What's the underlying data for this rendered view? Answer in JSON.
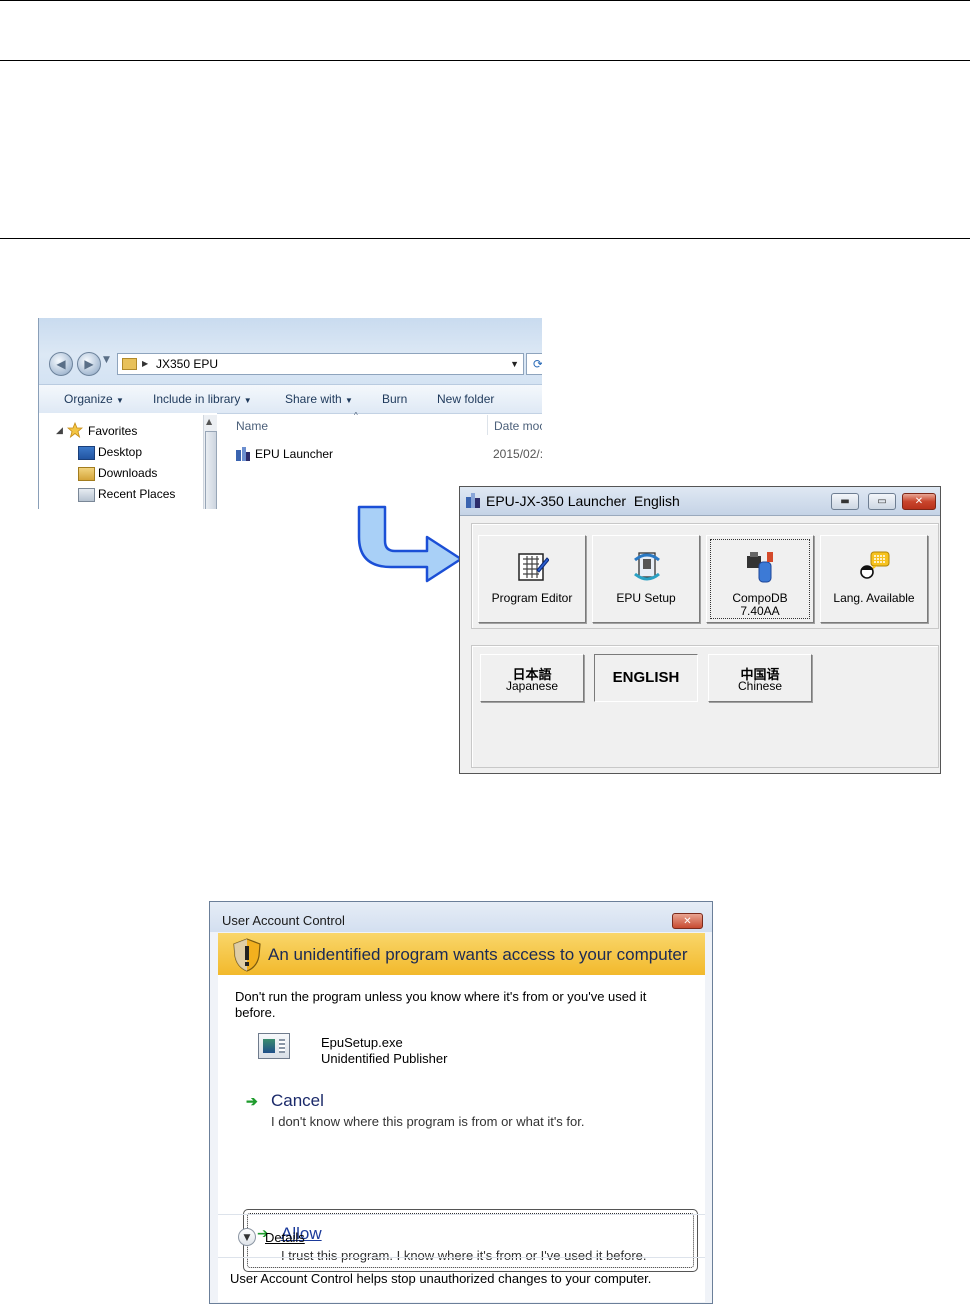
{
  "explorer": {
    "address_path": "JX350 EPU",
    "toolbar": {
      "organize": "Organize",
      "include_in_library": "Include in library",
      "share_with": "Share with",
      "burn": "Burn",
      "new_folder": "New folder"
    },
    "nav": {
      "favorites": "Favorites",
      "items": [
        "Desktop",
        "Downloads",
        "Recent Places"
      ]
    },
    "columns": {
      "name": "Name",
      "date": "Date moc"
    },
    "files": [
      {
        "name": "EPU Launcher",
        "date": "2015/02/:"
      }
    ]
  },
  "launcher": {
    "title": "EPU-JX-350 Launcher",
    "language": "English",
    "buttons": [
      {
        "label": "Program Editor",
        "icon": "grid-pencil-icon"
      },
      {
        "label": "EPU Setup",
        "icon": "setup-cube-icon"
      },
      {
        "label_line1": "CompoDB",
        "label_line2": "7.40AA",
        "icon": "database-parts-icon"
      },
      {
        "label": "Lang. Available",
        "icon": "speech-bubble-person-icon"
      }
    ],
    "languages": {
      "japanese_native": "日本語",
      "japanese": "Japanese",
      "english": "ENGLISH",
      "chinese_native": "中国语",
      "chinese": "Chinese"
    }
  },
  "uac": {
    "title": "User Account Control",
    "heading": "An unidentified program wants access to your computer",
    "message": "Don't run the program unless you know where it's from or you've used it before.",
    "program_name": "EpuSetup.exe",
    "publisher": "Unidentified Publisher",
    "cancel_label": "Cancel",
    "cancel_desc": "I don't know where this program is from or what it's for.",
    "allow_label": "Allow",
    "allow_desc": "I trust this program. I know where it's from or I've used it before.",
    "details_label": "Details",
    "footer": "User Account Control helps stop unauthorized changes to your computer."
  },
  "colors": {
    "uac_warning": "#f2b92c",
    "heading_text": "#1b2a55",
    "link_green": "#1e9b2c",
    "arrow_fill": "#a9d0f7",
    "arrow_stroke": "#1b4fd6"
  }
}
